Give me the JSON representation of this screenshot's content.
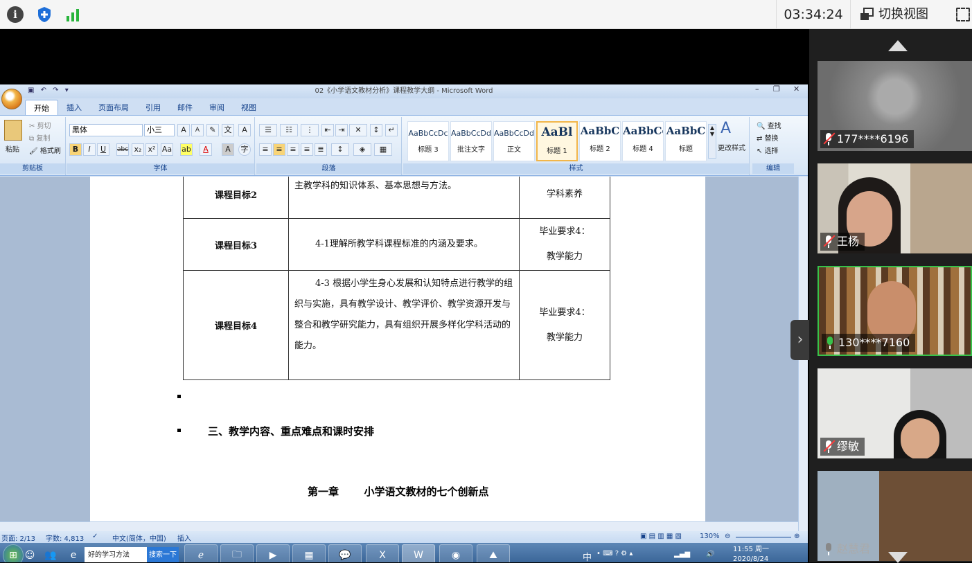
{
  "topbar": {
    "timer": "03:34:24",
    "switch_view": "切换视图"
  },
  "word": {
    "title": "02《小学语文教材分析》课程教学大纲 - Microsoft Word",
    "tabs": [
      "开始",
      "插入",
      "页面布局",
      "引用",
      "邮件",
      "审阅",
      "视图"
    ],
    "clipboard": {
      "paste": "粘贴",
      "cut": "剪切",
      "copy": "复制",
      "format_painter": "格式刷",
      "label": "剪贴板"
    },
    "font": {
      "name": "黑体",
      "size": "小三",
      "label": "字体"
    },
    "paragraph_label": "段落",
    "styles": [
      {
        "sample": "AaBbCcDc",
        "name": "标题 3"
      },
      {
        "sample": "AaBbCcDd",
        "name": "批注文字"
      },
      {
        "sample": "AaBbCcDd",
        "name": "正文"
      },
      {
        "sample": "AaBl",
        "name": "标题 1"
      },
      {
        "sample": "AaBbC",
        "name": "标题 2"
      },
      {
        "sample": "AaBbCc",
        "name": "标题 4"
      },
      {
        "sample": "AaBbC",
        "name": "标题"
      }
    ],
    "change_styles": "更改样式",
    "styles_label": "样式",
    "editing": {
      "find": "查找",
      "replace": "替换",
      "select": "选择",
      "label": "编辑"
    },
    "table": [
      {
        "goal": "课程目标2",
        "content": "主教学科的知识体系、基本思想与方法。",
        "req_a": "",
        "req_b": "学科素养"
      },
      {
        "goal": "课程目标3",
        "content": "4-1理解所教学科课程标准的内涵及要求。",
        "req_a": "毕业要求4：",
        "req_b": "教学能力"
      },
      {
        "goal": "课程目标4",
        "content": "4-3 根据小学生身心发展和认知特点进行教学的组织与实施，具有教学设计、教学评价、教学资源开发与整合和教学研究能力，具有组织开展多样化学科活动的能力。",
        "req_a": "毕业要求4：",
        "req_b": "教学能力"
      }
    ],
    "heading3": "三、教学内容、重点难点和课时安排",
    "chapter": "第一章       小学语文教材的七个创新点",
    "status": {
      "page": "页面: 2/13",
      "words": "字数: 4,813",
      "language": "中文(简体，中国)",
      "mode": "插入",
      "zoom": "130%"
    }
  },
  "taskbar": {
    "search_text": "好的学习方法",
    "search_button": "搜索一下",
    "ime": "中",
    "time": "11:55 周一",
    "date": "2020/8/24"
  },
  "participants": [
    {
      "name": "177****6196",
      "muted": true
    },
    {
      "name": "王杨",
      "muted": true
    },
    {
      "name": "130****7160",
      "muted": false
    },
    {
      "name": "缪敏",
      "muted": true
    },
    {
      "name": "赵慧君",
      "muted": true
    }
  ],
  "colors": {
    "active_speaker": "#37c24a",
    "muted_mic": "#ff3b3b",
    "word_blue": "#15428b"
  }
}
